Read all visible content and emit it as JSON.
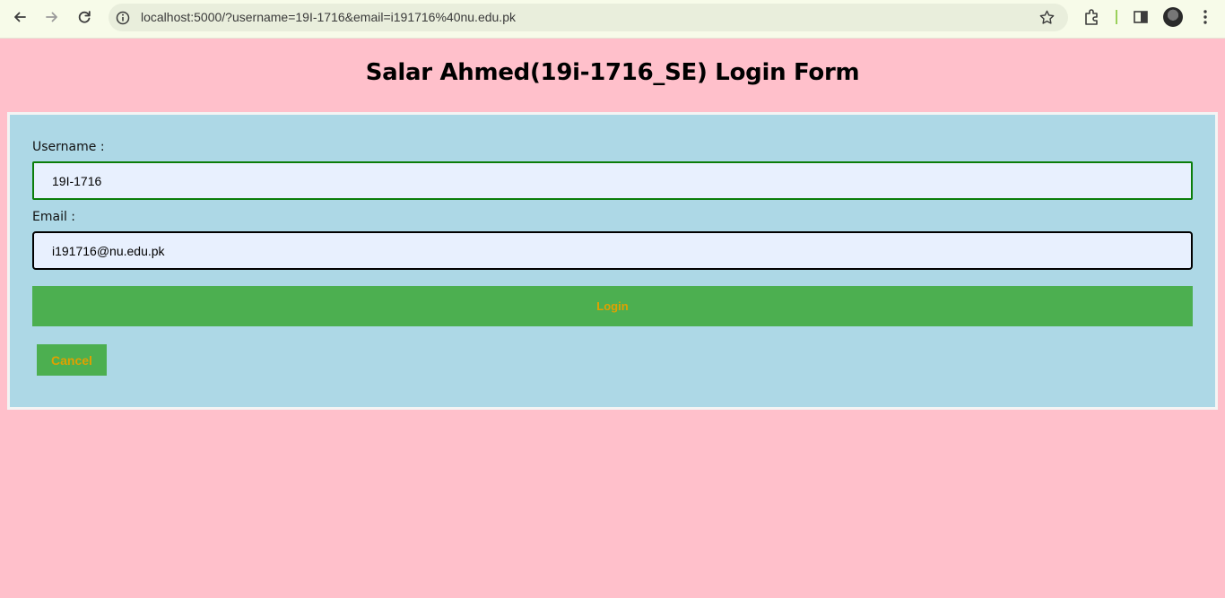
{
  "browser": {
    "url": "localhost:5000/?username=19I-1716&email=i191716%40nu.edu.pk",
    "icons": {
      "back": "back-arrow-icon",
      "forward": "forward-arrow-icon",
      "reload": "reload-icon",
      "site_info": "site-info-icon",
      "bookmark": "star-icon",
      "extensions": "puzzle-icon",
      "side_panel": "side-panel-icon",
      "profile": "avatar",
      "menu": "kebab-menu-icon"
    }
  },
  "page": {
    "title": "Salar Ahmed(19i-1716_SE) Login Form",
    "background_color": "#ffc0cb",
    "panel_color": "#add8e6"
  },
  "form": {
    "username_label": "Username :",
    "username_value": "19I-1716",
    "email_label": "Email :",
    "email_value": "i191716@nu.edu.pk",
    "login_label": "Login",
    "cancel_label": "Cancel",
    "button_color": "#4caf50",
    "button_text_color": "#e0a000"
  }
}
